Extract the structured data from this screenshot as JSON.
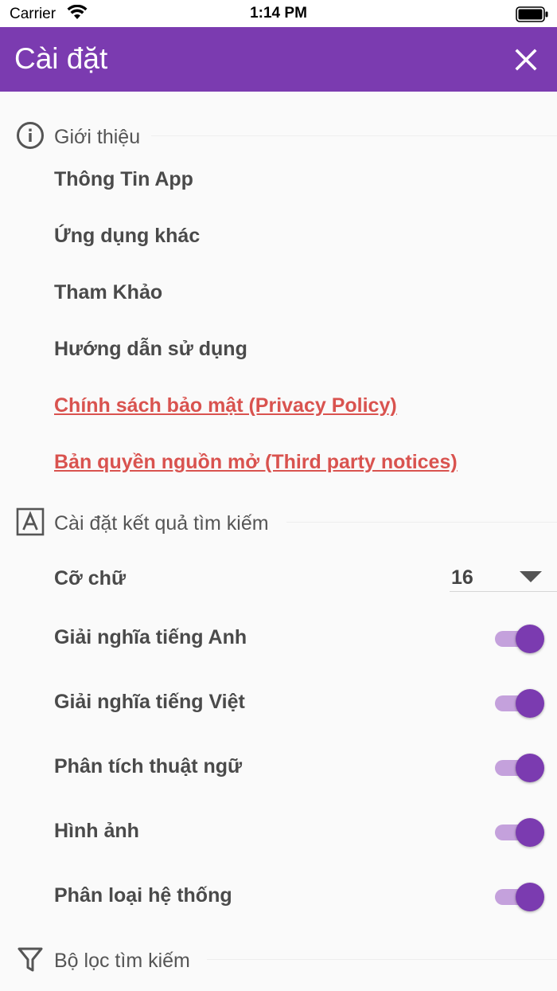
{
  "status_bar": {
    "carrier": "Carrier",
    "time": "1:14 PM",
    "icons": [
      "wifi-icon",
      "battery-icon"
    ]
  },
  "app_bar": {
    "title": "Cài đặt",
    "close_icon": "close-icon",
    "color": "#7b3bb0"
  },
  "sections": {
    "about": {
      "icon": "info-icon",
      "title": "Giới thiệu",
      "items": [
        {
          "label": "Thông Tin App"
        },
        {
          "label": "Ứng dụng khác"
        },
        {
          "label": "Tham Khảo"
        },
        {
          "label": "Hướng dẫn sử dụng"
        },
        {
          "label": "Chính sách bảo mật (Privacy Policy)",
          "color": "#d9534f"
        },
        {
          "label": "Bản quyền nguồn mở (Third party notices)",
          "color": "#d9534f"
        }
      ]
    },
    "search_results": {
      "icon": "font-icon",
      "title": "Cài đặt kết quả tìm kiếm",
      "font_size": {
        "label": "Cỡ chữ",
        "value": "16"
      },
      "toggles": [
        {
          "label": "Giải nghĩa tiếng Anh",
          "on": true
        },
        {
          "label": "Giải nghĩa tiếng Việt",
          "on": true
        },
        {
          "label": "Phân tích thuật ngữ",
          "on": true
        },
        {
          "label": "Hình ảnh",
          "on": true
        },
        {
          "label": "Phân loại hệ thống",
          "on": true
        }
      ]
    },
    "search_filter": {
      "icon": "filter-icon",
      "title": "Bộ lọc tìm kiếm"
    }
  }
}
